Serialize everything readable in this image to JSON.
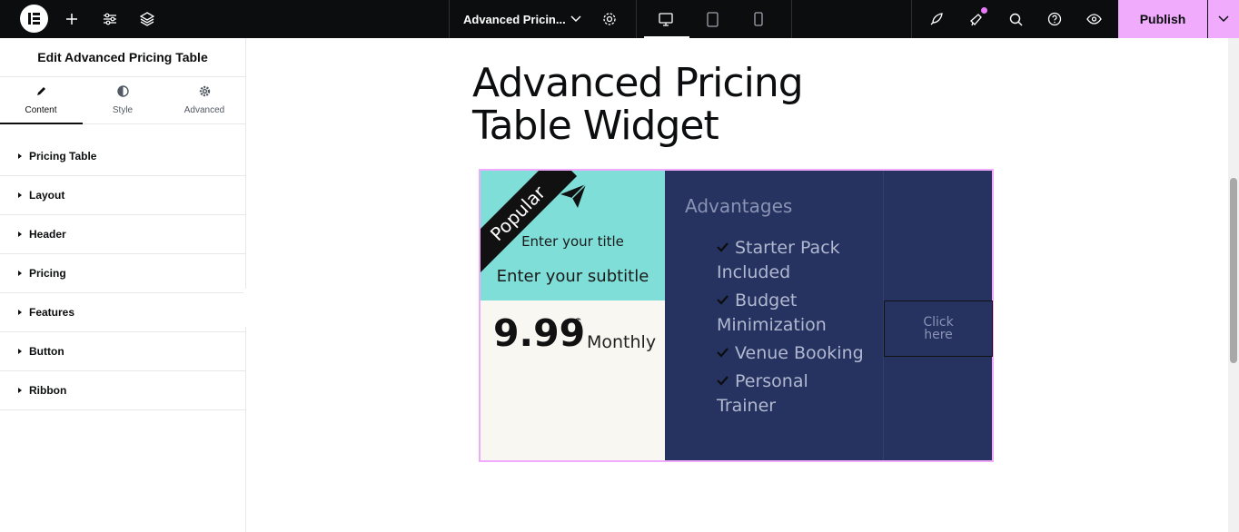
{
  "topbar": {
    "doc_title": "Advanced Pricin...",
    "publish_label": "Publish"
  },
  "panel": {
    "title": "Edit Advanced Pricing Table",
    "tabs": [
      {
        "label": "Content",
        "icon": "pencil-icon",
        "active": true
      },
      {
        "label": "Style",
        "icon": "half-circle-icon",
        "active": false
      },
      {
        "label": "Advanced",
        "icon": "gear-icon",
        "active": false
      }
    ],
    "sections": [
      "Pricing Table",
      "Layout",
      "Header",
      "Pricing",
      "Features",
      "Button",
      "Ribbon"
    ]
  },
  "canvas": {
    "widget_title": "Advanced Pricing Table Widget",
    "pricing_table": {
      "ribbon": "Popular",
      "title": "Enter your title",
      "subtitle": "Enter your subtitle",
      "price": "9.99",
      "currency": "$",
      "period": "Monthly",
      "features_title": "Advantages",
      "features": [
        "Starter Pack Included",
        "Budget Minimization",
        "Venue Booking",
        "Personal Trainer"
      ],
      "button_label": "Click here"
    }
  },
  "colors": {
    "topbar": "#0c0d0e",
    "accent": "#f0abfc",
    "header_bg": "#7fded8",
    "dark_bg": "#263360",
    "price_bg": "#f9f7f1"
  }
}
